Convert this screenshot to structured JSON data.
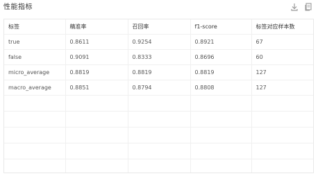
{
  "panel": {
    "title": "性能指标"
  },
  "toolbar": {
    "download_icon": "download-icon",
    "copy_icon": "copy-icon"
  },
  "table": {
    "headers": [
      "标签",
      "精准率",
      "召回率",
      "f1-score",
      "标签对应样本数"
    ],
    "rows": [
      [
        "true",
        "0.8611",
        "0.9254",
        "0.8921",
        "67"
      ],
      [
        "false",
        "0.9091",
        "0.8333",
        "0.8696",
        "60"
      ],
      [
        "micro_average",
        "0.8819",
        "0.8819",
        "0.8819",
        "127"
      ],
      [
        "macro_average",
        "0.8851",
        "0.8794",
        "0.8808",
        "127"
      ]
    ]
  },
  "colors": {
    "border": "#e8e8e8",
    "text": "#555555",
    "icon": "#999999"
  }
}
